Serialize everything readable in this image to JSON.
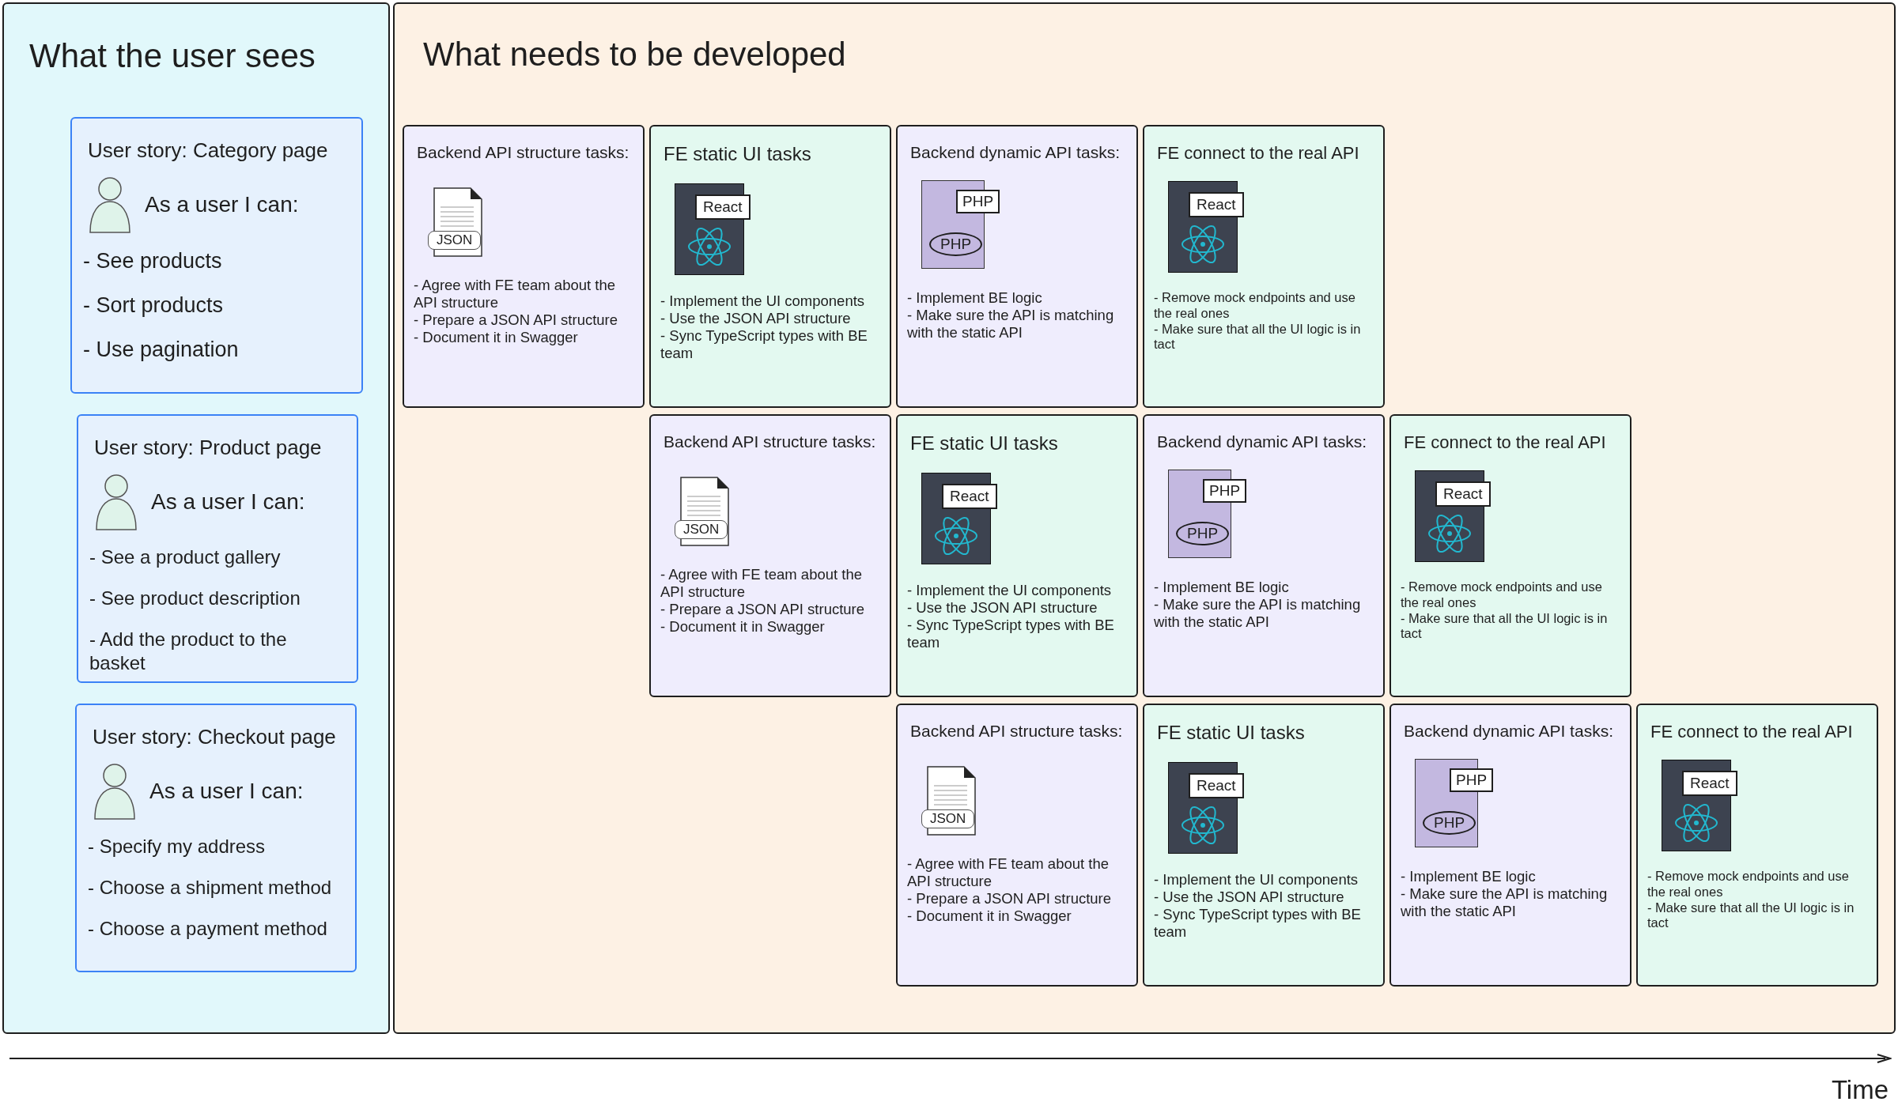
{
  "user_view": {
    "title": "What the user sees",
    "stories": [
      {
        "title": "User story: Category page",
        "heading": "As a user I can:",
        "items": [
          "- See products",
          "- Sort products",
          "- Use pagination"
        ]
      },
      {
        "title": "User story: Product page",
        "heading": "As a user I can:",
        "items": [
          "- See a product gallery",
          "- See product description",
          "- Add the product to the basket"
        ]
      },
      {
        "title": "User story: Checkout page",
        "heading": "As a user I can:",
        "items": [
          "- Specify my address",
          "- Choose a shipment method",
          "- Choose a payment method"
        ]
      }
    ]
  },
  "development": {
    "title": "What needs to be developed",
    "rows": [
      {
        "cards": [
          {
            "kind": "backend_structure",
            "title": "Backend API structure tasks:",
            "icon_labels": [
              "JSON"
            ],
            "tasks": [
              "- Agree with FE team about the API structure",
              "- Prepare a JSON API structure",
              "- Document it in Swagger"
            ]
          },
          {
            "kind": "fe_static",
            "title": "FE static UI tasks",
            "icon_labels": [
              "React"
            ],
            "tasks": [
              "- Implement the UI components",
              "- Use the JSON API structure",
              "- Sync TypeScript types with BE team"
            ]
          },
          {
            "kind": "backend_dynamic",
            "title": "Backend dynamic API tasks:",
            "icon_labels": [
              "PHP",
              "PHP"
            ],
            "tasks": [
              "- Implement BE logic",
              "- Make sure the API is matching with the static API"
            ]
          },
          {
            "kind": "fe_connect",
            "title": "FE connect to the real API",
            "icon_labels": [
              "React"
            ],
            "tasks": [
              "-  Remove mock endpoints and use the real ones",
              "- Make sure that all the UI logic is in tact"
            ]
          }
        ]
      },
      {
        "cards": [
          {
            "kind": "backend_structure",
            "title": "Backend API structure tasks:",
            "icon_labels": [
              "JSON"
            ],
            "tasks": [
              "- Agree with FE team about the API structure",
              "- Prepare a JSON API structure",
              "- Document it in Swagger"
            ]
          },
          {
            "kind": "fe_static",
            "title": "FE static UI tasks",
            "icon_labels": [
              "React"
            ],
            "tasks": [
              "- Implement the UI components",
              "- Use the JSON API structure",
              "- Sync TypeScript types with BE team"
            ]
          },
          {
            "kind": "backend_dynamic",
            "title": "Backend dynamic API tasks:",
            "icon_labels": [
              "PHP",
              "PHP"
            ],
            "tasks": [
              "- Implement BE logic",
              "- Make sure the API is matching with the static API"
            ]
          },
          {
            "kind": "fe_connect",
            "title": "FE connect to the real API",
            "icon_labels": [
              "React"
            ],
            "tasks": [
              "-  Remove mock endpoints and use the real ones",
              "- Make sure that all the UI logic is in tact"
            ]
          }
        ]
      },
      {
        "cards": [
          {
            "kind": "backend_structure",
            "title": "Backend API structure tasks:",
            "icon_labels": [
              "JSON"
            ],
            "tasks": [
              "- Agree with FE team about the API structure",
              "- Prepare a JSON API structure",
              "- Document it in Swagger"
            ]
          },
          {
            "kind": "fe_static",
            "title": "FE static UI tasks",
            "icon_labels": [
              "React"
            ],
            "tasks": [
              "- Implement the UI components",
              "- Use the JSON API structure",
              "- Sync TypeScript types with BE team"
            ]
          },
          {
            "kind": "backend_dynamic",
            "title": "Backend dynamic API tasks:",
            "icon_labels": [
              "PHP",
              "PHP"
            ],
            "tasks": [
              "- Implement BE logic",
              "- Make sure the API is matching with the static API"
            ]
          },
          {
            "kind": "fe_connect",
            "title": "FE connect to the real API",
            "icon_labels": [
              "React"
            ],
            "tasks": [
              "-  Remove mock endpoints and use the real ones",
              "- Make sure that all the UI logic is in tact"
            ]
          }
        ]
      }
    ]
  },
  "axis": {
    "label": "Time"
  }
}
